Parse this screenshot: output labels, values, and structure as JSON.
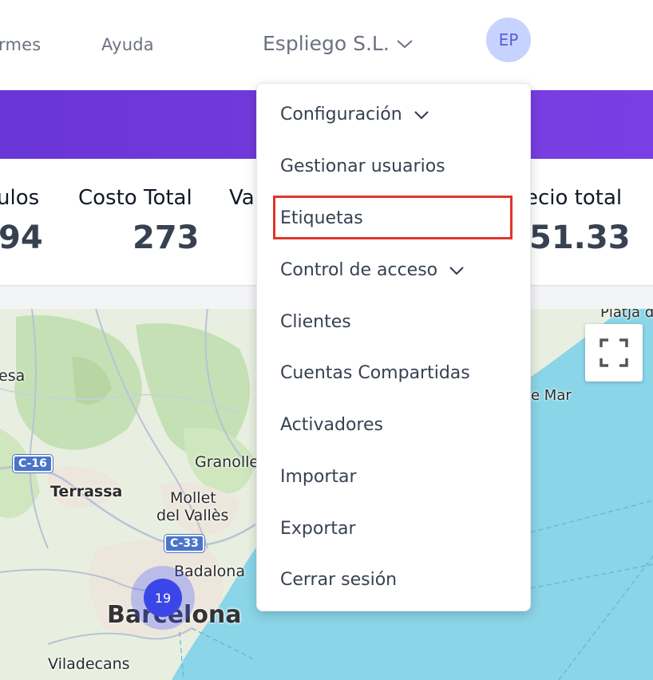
{
  "header": {
    "nav_partial": "rmes",
    "help": "Ayuda",
    "company": "Espliego S.L.",
    "avatar_initials": "EP"
  },
  "stats": {
    "items": [
      {
        "label": "ulos",
        "value": "94"
      },
      {
        "label": "Costo Total",
        "value": "273"
      },
      {
        "label": "Va",
        "value": ""
      },
      {
        "label": "ecio total",
        "value": "51.33"
      }
    ]
  },
  "menu": {
    "items": [
      {
        "label": "Configuración",
        "has_chevron": true
      },
      {
        "label": "Gestionar usuarios"
      },
      {
        "label": "Etiquetas",
        "highlighted": true
      },
      {
        "label": "Control de acceso",
        "has_chevron": true
      },
      {
        "label": "Clientes"
      },
      {
        "label": "Cuentas Compartidas"
      },
      {
        "label": "Activadores"
      },
      {
        "label": "Importar"
      },
      {
        "label": "Exportar"
      },
      {
        "label": "Cerrar sesión"
      }
    ]
  },
  "map": {
    "labels": {
      "esa": "esa",
      "terrassa": "Terrassa",
      "granollers": "Granolle",
      "mollet_1": "Mollet",
      "mollet_2": "del Vallès",
      "badalona": "Badalona",
      "barcelona": "Barcelona",
      "viladecans": "Viladecans",
      "platja": "Platja d",
      "de_mar": "e Mar"
    },
    "roads": {
      "c16": "C-16",
      "c33": "C-33"
    },
    "cluster_count": "19",
    "colors": {
      "sea": "#8ad5e8",
      "land": "#e8efe0",
      "forest": "#c5e0b4"
    }
  },
  "colors": {
    "banner": "#6a35d6",
    "accent": "#c7d2fe",
    "highlight": "#e0342b"
  }
}
